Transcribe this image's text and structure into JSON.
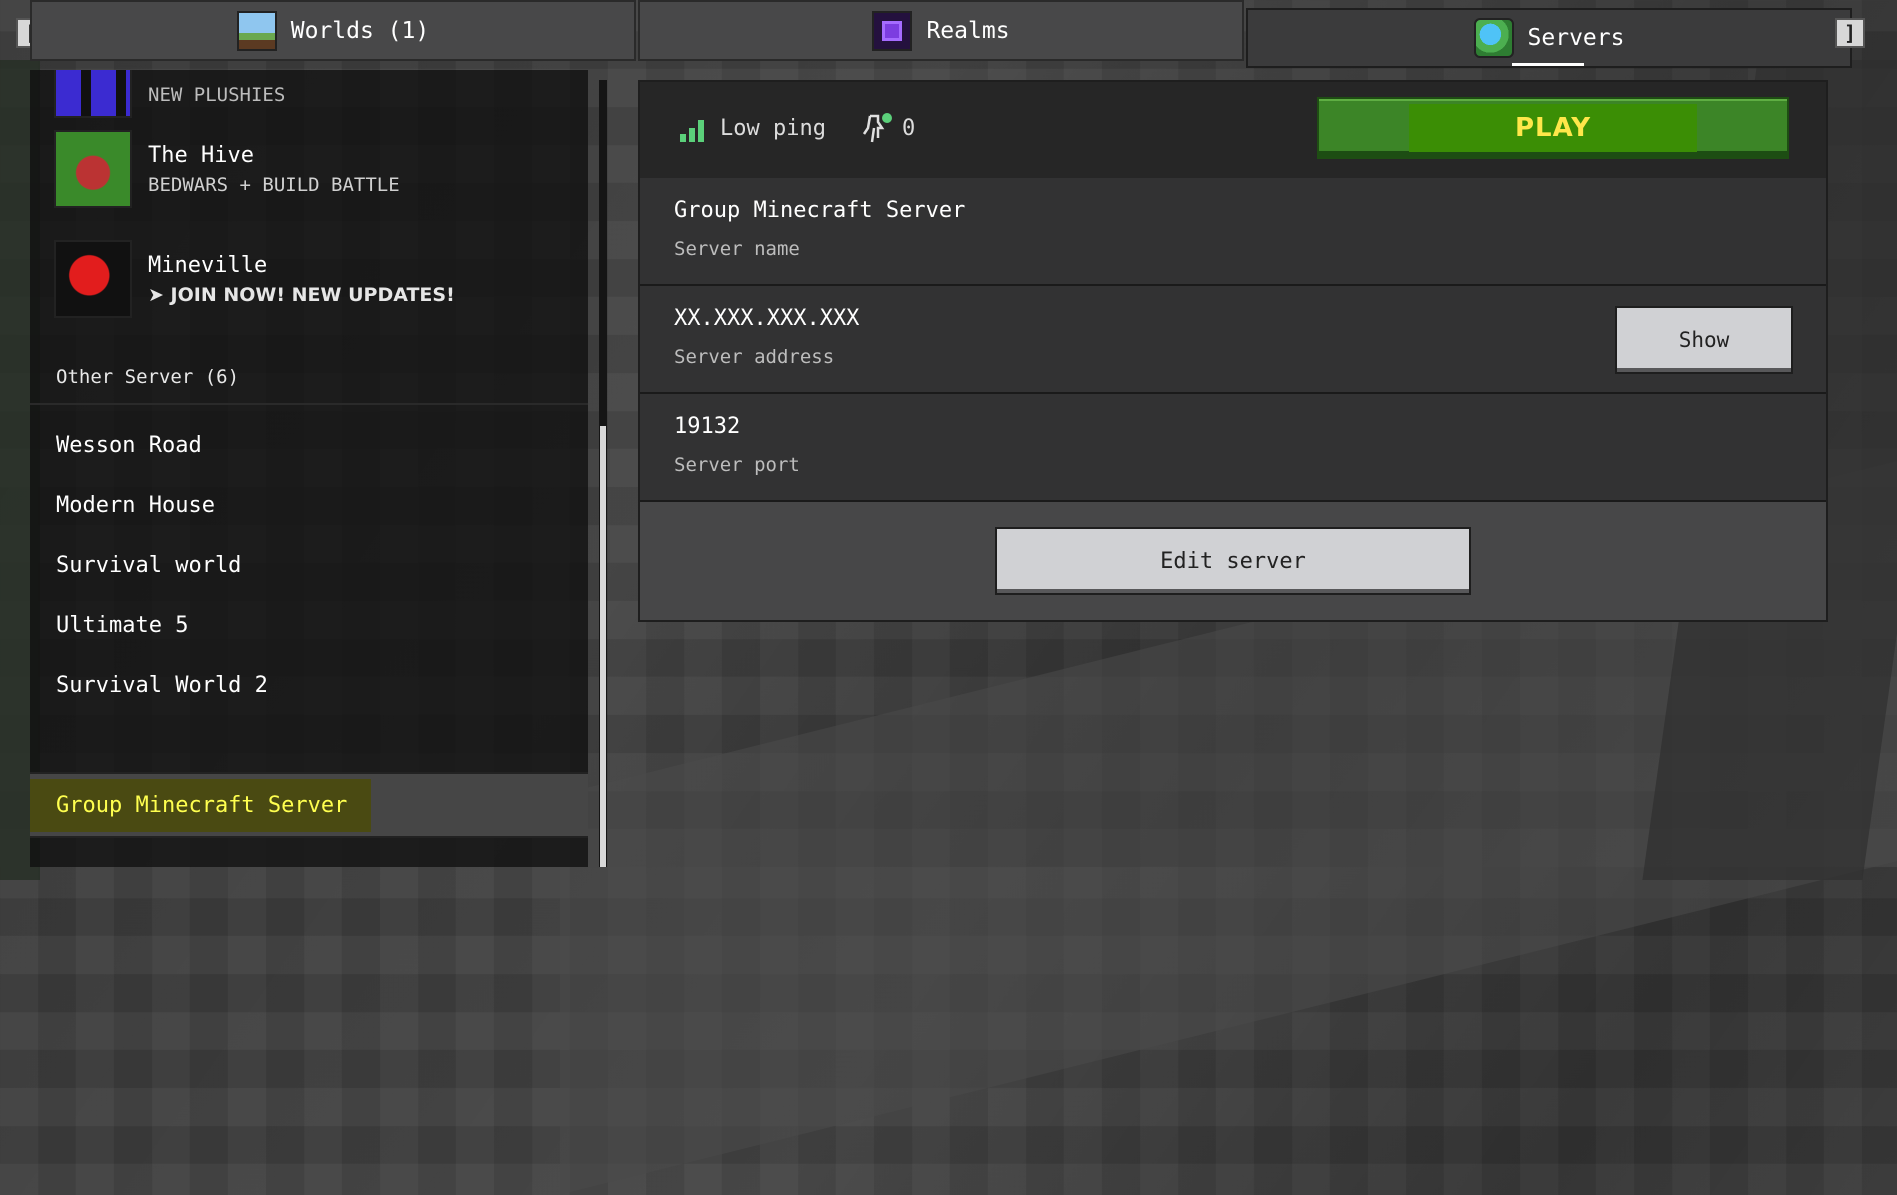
{
  "tabs": {
    "left_bracket": "[",
    "right_bracket": "]",
    "worlds": {
      "label": "Worlds (1)",
      "icon": "worlds-landscape-icon"
    },
    "realms": {
      "label": "Realms",
      "icon": "realms-portal-icon"
    },
    "servers": {
      "label": "Servers",
      "icon": "servers-globe-icon",
      "active": true
    }
  },
  "featured_servers": [
    {
      "title": "",
      "subtitle": "NEW PLUSHIES",
      "icon": "plushies-thumbnail-icon"
    },
    {
      "title": "The Hive",
      "subtitle": "BEDWARS + BUILD BATTLE",
      "icon": "hive-bed-thumbnail-icon"
    },
    {
      "title": "Mineville",
      "subtitle": "➤ JOIN NOW! NEW UPDATES!",
      "icon": "mineville-heart-thumbnail-icon"
    }
  ],
  "other_servers": {
    "heading": "Other Server (6)",
    "items": [
      {
        "label": "Wesson Road"
      },
      {
        "label": "Modern House"
      },
      {
        "label": "Survival world"
      },
      {
        "label": "Ultimate 5"
      },
      {
        "label": "Survival World 2"
      },
      {
        "label": "Group Minecraft Server",
        "selected": true
      }
    ]
  },
  "details": {
    "ping_label": "Low ping",
    "player_count": "0",
    "play_label": "PLAY",
    "server_name_value": "Group Minecraft Server",
    "server_name_label": "Server name",
    "server_address_value": "XX.XXX.XXX.XXX",
    "server_address_label": "Server address",
    "show_label": "Show",
    "server_port_value": "19132",
    "server_port_label": "Server port",
    "edit_label": "Edit server"
  },
  "colors": {
    "play_green": "#3c8527",
    "play_text": "#ffe74a",
    "selected_text": "#ffff4f",
    "ping_green": "#5bd07a"
  }
}
